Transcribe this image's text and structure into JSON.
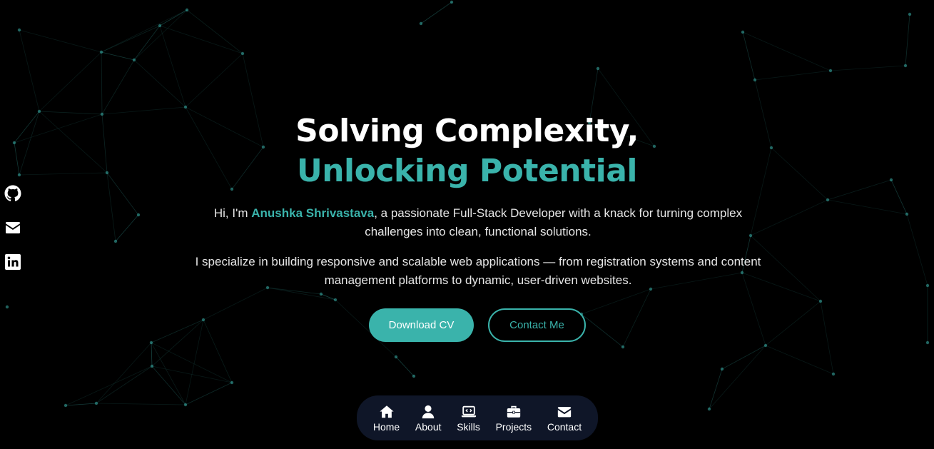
{
  "hero": {
    "title_line1": "Solving Complexity,",
    "title_line2": "Unlocking Potential",
    "intro_prefix": "Hi, I'm ",
    "name": "Anushka Shrivastava",
    "intro_suffix": ", a passionate Full-Stack Developer with a knack for turning complex challenges into clean, functional solutions.",
    "description": "I specialize in building responsive and scalable web applications — from registration systems and content management platforms to dynamic, user-driven websites.",
    "download_cv_label": "Download CV",
    "contact_me_label": "Contact Me"
  },
  "social": [
    {
      "icon": "github-icon"
    },
    {
      "icon": "envelope-icon"
    },
    {
      "icon": "linkedin-icon"
    }
  ],
  "nav": {
    "items": [
      {
        "label": "Home",
        "icon": "home-icon"
      },
      {
        "label": "About",
        "icon": "user-icon"
      },
      {
        "label": "Skills",
        "icon": "laptop-code-icon"
      },
      {
        "label": "Projects",
        "icon": "briefcase-icon"
      },
      {
        "label": "Contact",
        "icon": "envelope-icon"
      }
    ]
  },
  "colors": {
    "accent": "#3ab3ab",
    "background": "#000000",
    "nav_background": "#0f1628",
    "network_line": "#1f5e5a"
  }
}
